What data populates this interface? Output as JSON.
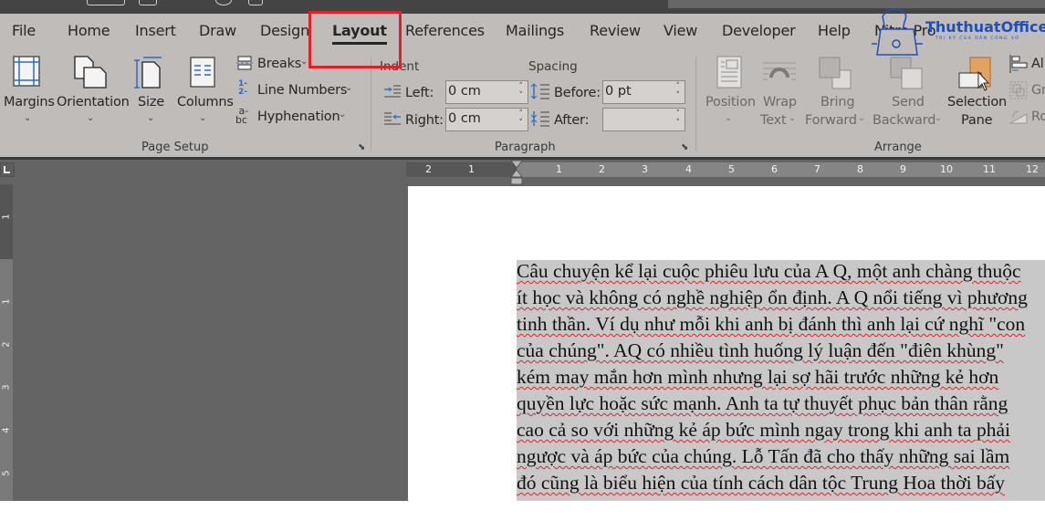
{
  "app": {
    "name": "Microsoft Word"
  },
  "tabs": [
    {
      "label": "File",
      "active": false
    },
    {
      "label": "Home",
      "active": false
    },
    {
      "label": "Insert",
      "active": false
    },
    {
      "label": "Draw",
      "active": false
    },
    {
      "label": "Design",
      "active": false
    },
    {
      "label": "Layout",
      "active": true
    },
    {
      "label": "References",
      "active": false
    },
    {
      "label": "Mailings",
      "active": false
    },
    {
      "label": "Review",
      "active": false
    },
    {
      "label": "View",
      "active": false
    },
    {
      "label": "Developer",
      "active": false
    },
    {
      "label": "Help",
      "active": false
    },
    {
      "label": "Nitro Pro",
      "active": false
    }
  ],
  "watermark": {
    "brand": "ThuthuatOffice",
    "tagline": "TRI KỶ CỦA DÂN CÔNG SỞ"
  },
  "ribbon": {
    "page_setup": {
      "label": "Page Setup",
      "margins": "Margins",
      "orientation": "Orientation",
      "size": "Size",
      "columns": "Columns",
      "breaks": "Breaks",
      "line_numbers": "Line Numbers",
      "hyphenation": "Hyphenation"
    },
    "paragraph": {
      "label": "Paragraph",
      "indent_heading": "Indent",
      "spacing_heading": "Spacing",
      "left_label": "Left:",
      "left_value": "0 cm",
      "right_label": "Right:",
      "right_value": "0 cm",
      "before_label": "Before:",
      "before_value": "0 pt",
      "after_label": "After:",
      "after_value": ""
    },
    "arrange": {
      "label": "Arrange",
      "position": "Position",
      "wrap_text_1": "Wrap",
      "wrap_text_2": "Text",
      "bring_forward_1": "Bring",
      "bring_forward_2": "Forward",
      "send_backward_1": "Send",
      "send_backward_2": "Backward",
      "selection_pane_1": "Selection",
      "selection_pane_2": "Pane",
      "align": "Al",
      "group": "Gr",
      "rotate": "Ro"
    }
  },
  "rulers": {
    "horizontal_labels": [
      "2",
      "1",
      "1",
      "2",
      "3",
      "4",
      "5",
      "6",
      "7",
      "8",
      "9",
      "10",
      "11",
      "12"
    ],
    "vertical_labels": [
      "1",
      "1",
      "2",
      "3",
      "4",
      "5"
    ]
  },
  "document": {
    "lines": [
      "Câu chuyện kể lại cuộc phiêu lưu của A Q, một anh chàng thuộc",
      "ít học và không có nghề nghiệp ổn định. A Q nổi tiếng vì phương",
      "tinh thần. Ví dụ như mỗi khi anh bị đánh thì anh lại cứ nghĩ \"con",
      "của chúng\". AQ có nhiều tình huống lý luận đến \"điên khùng\"",
      "kém may mắn hơn mình nhưng lại sợ hãi trước những kẻ hơn",
      "quyền lực hoặc sức mạnh. Anh ta tự thuyết phục bản thân rằng",
      "cao cả so với những kẻ áp bức mình ngay trong khi anh ta phải",
      "ngược và áp bức của chúng. Lỗ Tấn đã cho thấy những sai lầm",
      "đó cũng là biểu hiện của tính cách dân tộc Trung Hoa thời bấy"
    ]
  },
  "colors": {
    "ribbon_bg": "#c0bcb9",
    "highlight_border": "#e81d25",
    "selection_bg": "#c8c8c8",
    "spellcheck": "#d8262b",
    "workspace": "#646464",
    "accent_blue": "#2b6cc4"
  }
}
